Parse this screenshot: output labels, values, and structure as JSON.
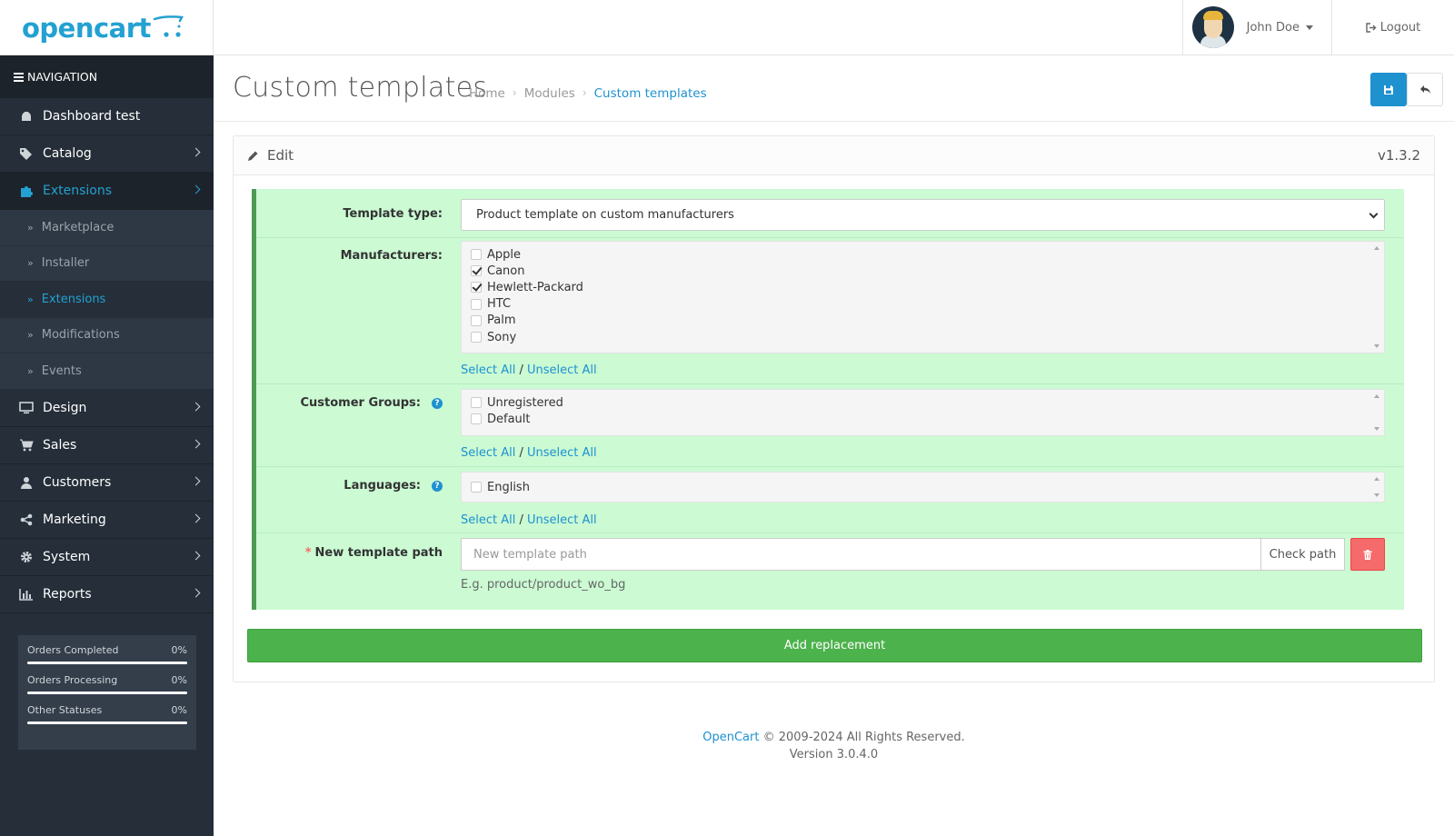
{
  "header": {
    "brand": "opencart",
    "user_name": "John Doe",
    "logout_label": "Logout"
  },
  "sidebar": {
    "navigation_label": "NAVIGATION",
    "items": [
      {
        "label": "Dashboard test",
        "icon": "dashboard-icon"
      },
      {
        "label": "Catalog",
        "icon": "tags-icon"
      },
      {
        "label": "Extensions",
        "icon": "puzzle-icon"
      },
      {
        "label": "Design",
        "icon": "monitor-icon"
      },
      {
        "label": "Sales",
        "icon": "cart-icon"
      },
      {
        "label": "Customers",
        "icon": "user-icon"
      },
      {
        "label": "Marketing",
        "icon": "share-icon"
      },
      {
        "label": "System",
        "icon": "cog-icon"
      },
      {
        "label": "Reports",
        "icon": "bar-chart-icon"
      }
    ],
    "sub_items": [
      {
        "label": "Marketplace"
      },
      {
        "label": "Installer"
      },
      {
        "label": "Extensions"
      },
      {
        "label": "Modifications"
      },
      {
        "label": "Events"
      }
    ],
    "stats": [
      {
        "label": "Orders Completed",
        "value": "0%",
        "progress": 0
      },
      {
        "label": "Orders Processing",
        "value": "0%",
        "progress": 0
      },
      {
        "label": "Other Statuses",
        "value": "0%",
        "progress": 0
      }
    ]
  },
  "page": {
    "title": "Custom templates",
    "breadcrumb": [
      "Home",
      "Modules",
      "Custom templates"
    ]
  },
  "panel": {
    "heading": "Edit",
    "version": "v1.3.2"
  },
  "form": {
    "template_type_label": "Template type:",
    "template_type_value": "Product template on custom manufacturers",
    "manufacturers_label": "Manufacturers:",
    "manufacturers": [
      {
        "name": "Apple",
        "checked": false
      },
      {
        "name": "Canon",
        "checked": true
      },
      {
        "name": "Hewlett-Packard",
        "checked": true
      },
      {
        "name": "HTC",
        "checked": false
      },
      {
        "name": "Palm",
        "checked": false
      },
      {
        "name": "Sony",
        "checked": false
      }
    ],
    "customer_groups_label": "Customer Groups:",
    "customer_groups": [
      {
        "name": "Unregistered",
        "checked": false
      },
      {
        "name": "Default",
        "checked": false
      }
    ],
    "languages_label": "Languages:",
    "languages": [
      {
        "name": "English",
        "checked": false
      }
    ],
    "select_all": "Select All",
    "slash": " / ",
    "unselect_all": "Unselect All",
    "path_required_mark": "*",
    "path_label": "New template path",
    "path_placeholder": "New template path",
    "check_path_label": "Check path",
    "path_hint": "E.g. product/product_wo_bg",
    "add_replacement_label": "Add replacement"
  },
  "footer": {
    "link": "OpenCart",
    "copyright": " © 2009-2024 All Rights Reserved.",
    "version": "Version 3.0.4.0"
  },
  "colors": {
    "accent": "#1e91cf",
    "sidebar_bg": "#252e39",
    "green_panel": "#cbfad3",
    "add_button": "#4cb24c",
    "delete_button": "#f56b6b"
  }
}
